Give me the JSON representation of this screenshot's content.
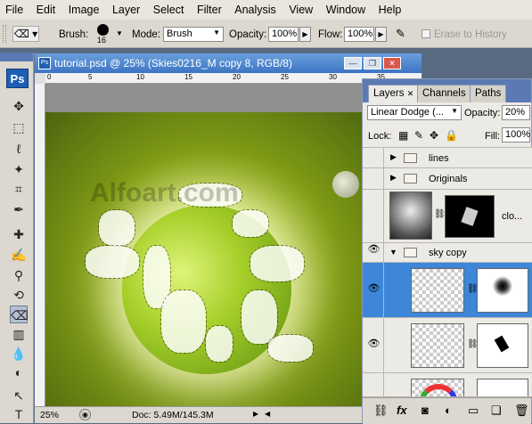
{
  "menu": [
    "File",
    "Edit",
    "Image",
    "Layer",
    "Select",
    "Filter",
    "Analysis",
    "View",
    "Window",
    "Help"
  ],
  "options": {
    "brush_label": "Brush:",
    "brush_size": "16",
    "mode_label": "Mode:",
    "mode_value": "Brush",
    "opacity_label": "Opacity:",
    "opacity_value": "100%",
    "flow_label": "Flow:",
    "flow_value": "100%",
    "erase_history": "Erase to History"
  },
  "toolbox": {
    "logo": "Ps"
  },
  "document": {
    "title": "tutorial.psd @ 25% (Skies0216_M copy 8, RGB/8)",
    "watermark": "Alfoart.com",
    "zoom": "25%",
    "doc_info": "Doc: 5.49M/145.3M",
    "ruler_labels": [
      "0",
      "5",
      "10",
      "15",
      "20",
      "25",
      "30",
      "35"
    ]
  },
  "layers_panel": {
    "tabs": [
      "Layers",
      "Channels",
      "Paths"
    ],
    "blend_mode": "Linear Dodge (...",
    "opacity_label": "Opacity:",
    "opacity_value": "20%",
    "lock_label": "Lock:",
    "fill_label": "Fill:",
    "fill_value": "100%",
    "rows": [
      {
        "name": "lines"
      },
      {
        "name": "Originals"
      },
      {
        "name": "clo..."
      },
      {
        "name": "sky copy"
      }
    ],
    "bottom_icons": [
      "link-icon",
      "fx-icon",
      "mask-icon",
      "adjustment-icon",
      "folder-icon",
      "new-layer-icon",
      "trash-icon"
    ]
  }
}
